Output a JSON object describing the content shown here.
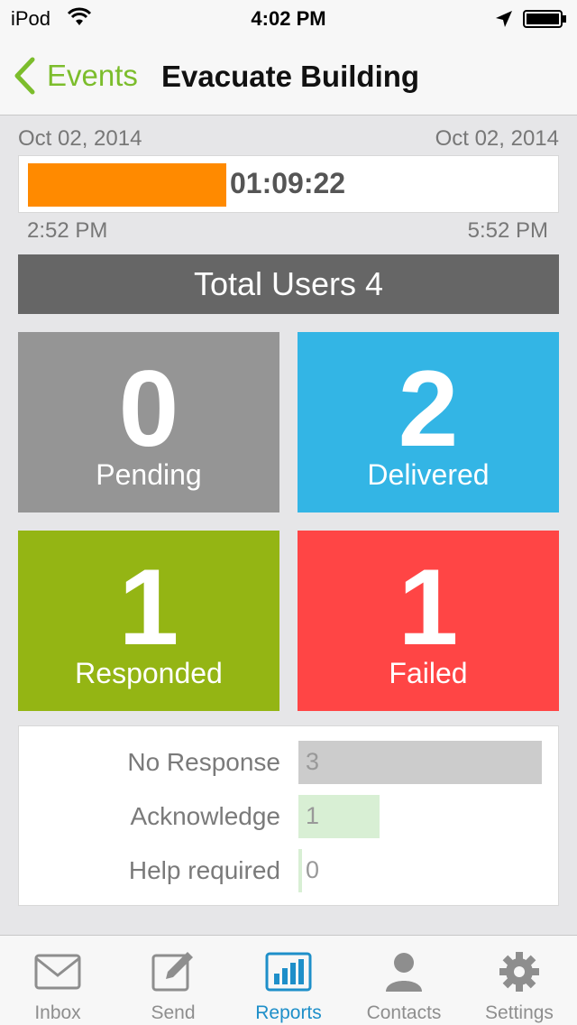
{
  "status_bar": {
    "carrier": "iPod",
    "time": "4:02 PM"
  },
  "nav": {
    "back_label": "Events",
    "title": "Evacuate Building"
  },
  "timeline": {
    "start_date": "Oct 02, 2014",
    "end_date": "Oct 02, 2014",
    "start_time": "2:52 PM",
    "end_time": "5:52 PM",
    "remaining": "01:09:22",
    "elapsed_fraction": 0.38,
    "fill_color": "#ff8a00"
  },
  "total_users": "Total Users 4",
  "tiles": {
    "pending": {
      "count": "0",
      "label": "Pending",
      "color": "#959595"
    },
    "delivered": {
      "count": "2",
      "label": "Delivered",
      "color": "#33b5e5"
    },
    "responded": {
      "count": "1",
      "label": "Responded",
      "color": "#94b514"
    },
    "failed": {
      "count": "1",
      "label": "Failed",
      "color": "#ff4545"
    }
  },
  "responses": [
    {
      "label": "No Response",
      "value": "3",
      "fraction": 1.0,
      "color": "#cccccc"
    },
    {
      "label": "Acknowledge",
      "value": "1",
      "fraction": 0.333,
      "color": "#d8efd4"
    },
    {
      "label": "Help required",
      "value": "0",
      "fraction": 0.0,
      "color": "#d8efd4"
    }
  ],
  "tabs": [
    {
      "label": "Inbox",
      "icon": "envelope-icon",
      "active": false
    },
    {
      "label": "Send",
      "icon": "compose-icon",
      "active": false
    },
    {
      "label": "Reports",
      "icon": "bar-chart-icon",
      "active": true
    },
    {
      "label": "Contacts",
      "icon": "person-icon",
      "active": false
    },
    {
      "label": "Settings",
      "icon": "gear-icon",
      "active": false
    }
  ],
  "colors": {
    "accent_green": "#7cbd2c",
    "active_tab": "#1e8fc9"
  }
}
